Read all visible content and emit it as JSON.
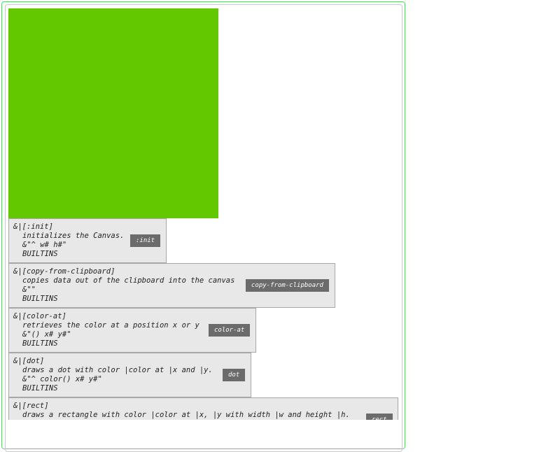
{
  "colors": {
    "canvas_fill": "#63c800",
    "window_border": "#5fcf6f",
    "card_bg": "#e8e8e8",
    "button_bg": "#6b6b6b"
  },
  "methods": [
    {
      "header": "&|[:init]",
      "description": "initializes the Canvas.",
      "signature": "&\"^ w# h#\"",
      "category": "BUILTINS",
      "button": ":init"
    },
    {
      "header": "&|[copy-from-clipboard]",
      "description": "copies data out of the clipboard into the canvas",
      "signature": "&\"\"",
      "category": "BUILTINS",
      "button": "copy-from-clipboard"
    },
    {
      "header": "&|[color-at]",
      "description": "retrieves the color at a position x or y",
      "signature": "&\"() x# y#\"",
      "category": "BUILTINS",
      "button": "color-at"
    },
    {
      "header": "&|[dot]",
      "description": "draws a dot with color |color at |x and |y.",
      "signature": "&\"^ color() x# y#\"",
      "category": "BUILTINS",
      "button": "dot"
    },
    {
      "header": "&|[rect]",
      "description": "draws a rectangle with color |color at |x, |y with width |w and height |h.",
      "signature": "",
      "category": "",
      "button": "rect"
    }
  ]
}
